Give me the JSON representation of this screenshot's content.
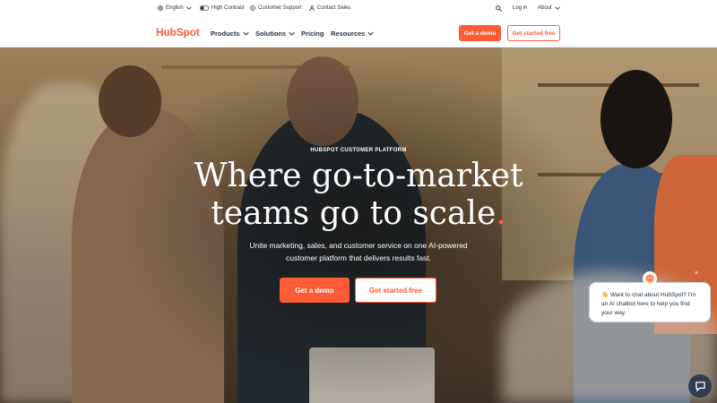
{
  "utility": {
    "language": "English",
    "high_contrast": "High Contrast",
    "customer_support": "Customer Support",
    "contact_sales": "Contact Sales",
    "login": "Log in",
    "about": "About"
  },
  "nav": {
    "logo": "HubSpot",
    "items": [
      "Products",
      "Solutions",
      "Pricing",
      "Resources"
    ],
    "get_demo": "Get a demo",
    "get_started": "Get started free"
  },
  "hero": {
    "eyebrow": "HUBSPOT CUSTOMER PLATFORM",
    "headline_line1": "Where go-to-market",
    "headline_line2": "teams go to scale",
    "headline_dot": ".",
    "subtext_line1": "Unite marketing, sales, and customer service on one AI-powered",
    "subtext_line2": "customer platform that delivers results fast.",
    "get_demo": "Get a demo",
    "get_started": "Get started free"
  },
  "chat": {
    "message": "👋 Want to chat about HubSpot? I'm an AI chatbot here to help you find your way.",
    "close": "×"
  },
  "colors": {
    "brand": "#ff5c35",
    "text": "#213343",
    "chat_launcher": "#2d3e50"
  },
  "icons": [
    "globe-icon",
    "toggle-icon",
    "support-icon",
    "person-icon",
    "search-icon",
    "chevron-down-icon",
    "chat-icon"
  ]
}
